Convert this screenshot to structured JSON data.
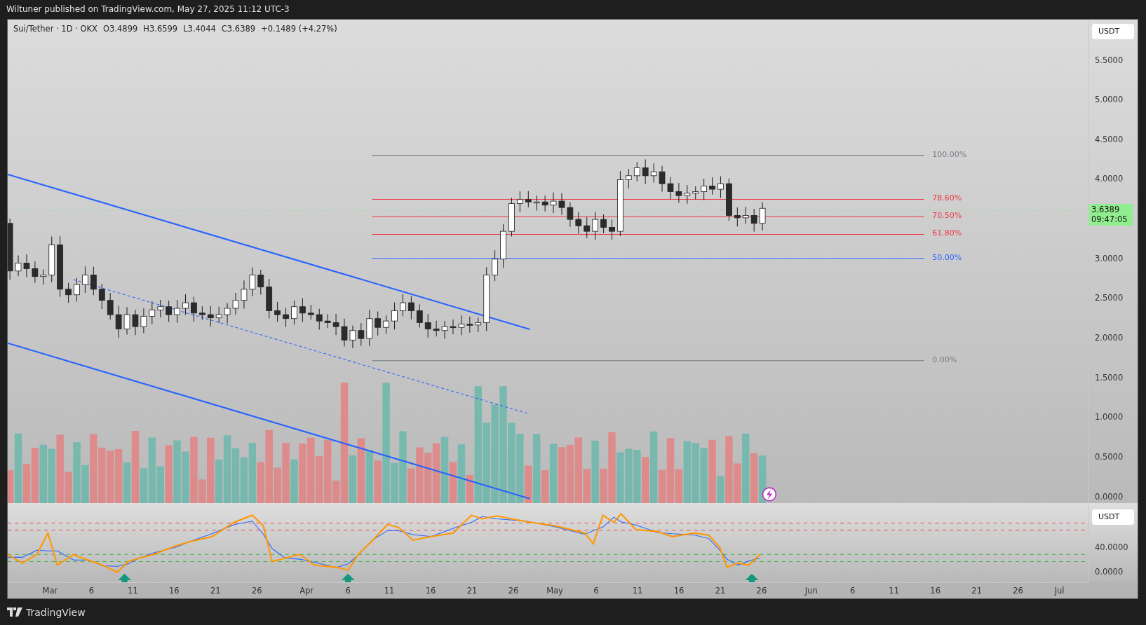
{
  "header": {
    "publisher": "Wiltuner published on TradingView.com, May 27, 2025 11:12 UTC-3"
  },
  "legend": {
    "symbol": "Sui/Tether · 1D · OKX",
    "open": "O3.4899",
    "high": "H3.6599",
    "low": "L3.4044",
    "close": "C3.6389",
    "change": "+0.1489 (+4.27%)"
  },
  "price_axis": {
    "currency": "USDT",
    "ticks": [
      "5.5000",
      "5.0000",
      "4.5000",
      "4.0000",
      "3.0000",
      "2.5000",
      "2.0000",
      "1.5000",
      "1.0000",
      "0.5000",
      "0.0000"
    ],
    "last_price": "3.6389",
    "countdown": "09:47:05"
  },
  "fib_levels": [
    {
      "label": "100.00%",
      "color": "#787b86"
    },
    {
      "label": "78.60%",
      "color": "#f23645"
    },
    {
      "label": "70.50%",
      "color": "#f23645"
    },
    {
      "label": "61.80%",
      "color": "#f23645"
    },
    {
      "label": "50.00%",
      "color": "#2962ff"
    },
    {
      "label": "0.00%",
      "color": "#787b86"
    }
  ],
  "oscillator_axis": {
    "currency": "USDT",
    "ticks": [
      "40.0000",
      "0.0000"
    ]
  },
  "time_axis": {
    "labels": [
      "Mar",
      "6",
      "11",
      "16",
      "21",
      "26",
      "Apr",
      "6",
      "11",
      "16",
      "21",
      "26",
      "May",
      "6",
      "11",
      "16",
      "21",
      "26",
      "Jun",
      "6",
      "11",
      "16",
      "21",
      "26",
      "Jul"
    ]
  },
  "footer": {
    "brand": "TradingView"
  }
}
